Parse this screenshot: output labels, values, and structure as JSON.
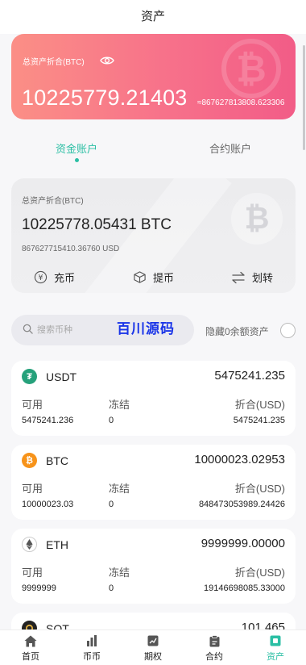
{
  "header": {
    "title": "资产"
  },
  "hero": {
    "label": "总资产折合(BTC)",
    "value": "10225779.21403",
    "approx": "≈867627813808.623306"
  },
  "tabs": [
    {
      "label": "资金账户",
      "active": true
    },
    {
      "label": "合约账户",
      "active": false
    }
  ],
  "account": {
    "label": "总资产折合(BTC)",
    "btc_value": "10225778.05431 BTC",
    "usd_value": "867627715410.36760 USD",
    "actions": [
      {
        "label": "充币",
        "icon": "deposit-icon"
      },
      {
        "label": "提币",
        "icon": "withdraw-icon"
      },
      {
        "label": "划转",
        "icon": "transfer-icon"
      }
    ]
  },
  "search": {
    "placeholder": "搜索币种"
  },
  "watermark": "百川源码",
  "hide_zero_label": "隐藏0余额资产",
  "assets": [
    {
      "name": "USDT",
      "total": "5475241.235",
      "available_label": "可用",
      "frozen_label": "冻结",
      "converted_label": "折合(USD)",
      "available": "5475241.236",
      "frozen": "0",
      "converted": "5475241.235",
      "color": "#26a17b"
    },
    {
      "name": "BTC",
      "total": "10000023.02953",
      "available_label": "可用",
      "frozen_label": "冻结",
      "converted_label": "折合(USD)",
      "available": "10000023.03",
      "frozen": "0",
      "converted": "848473053989.24426",
      "color": "#f7931a"
    },
    {
      "name": "ETH",
      "total": "9999999.00000",
      "available_label": "可用",
      "frozen_label": "冻结",
      "converted_label": "折合(USD)",
      "available": "9999999",
      "frozen": "0",
      "converted": "19146698085.33000",
      "color": "#627eea"
    },
    {
      "name": "SOT",
      "total": "101.465",
      "color": "#222222"
    }
  ],
  "tabbar": [
    {
      "label": "首页",
      "icon": "home-icon",
      "active": false
    },
    {
      "label": "币币",
      "icon": "bar-chart-icon",
      "active": false
    },
    {
      "label": "期权",
      "icon": "options-icon",
      "active": false
    },
    {
      "label": "合约",
      "icon": "clipboard-icon",
      "active": false
    },
    {
      "label": "资产",
      "icon": "wallet-icon",
      "active": true
    }
  ],
  "colors": {
    "accent": "#2bbfa4",
    "hero_start": "#fb8f86",
    "hero_end": "#f25c87"
  }
}
